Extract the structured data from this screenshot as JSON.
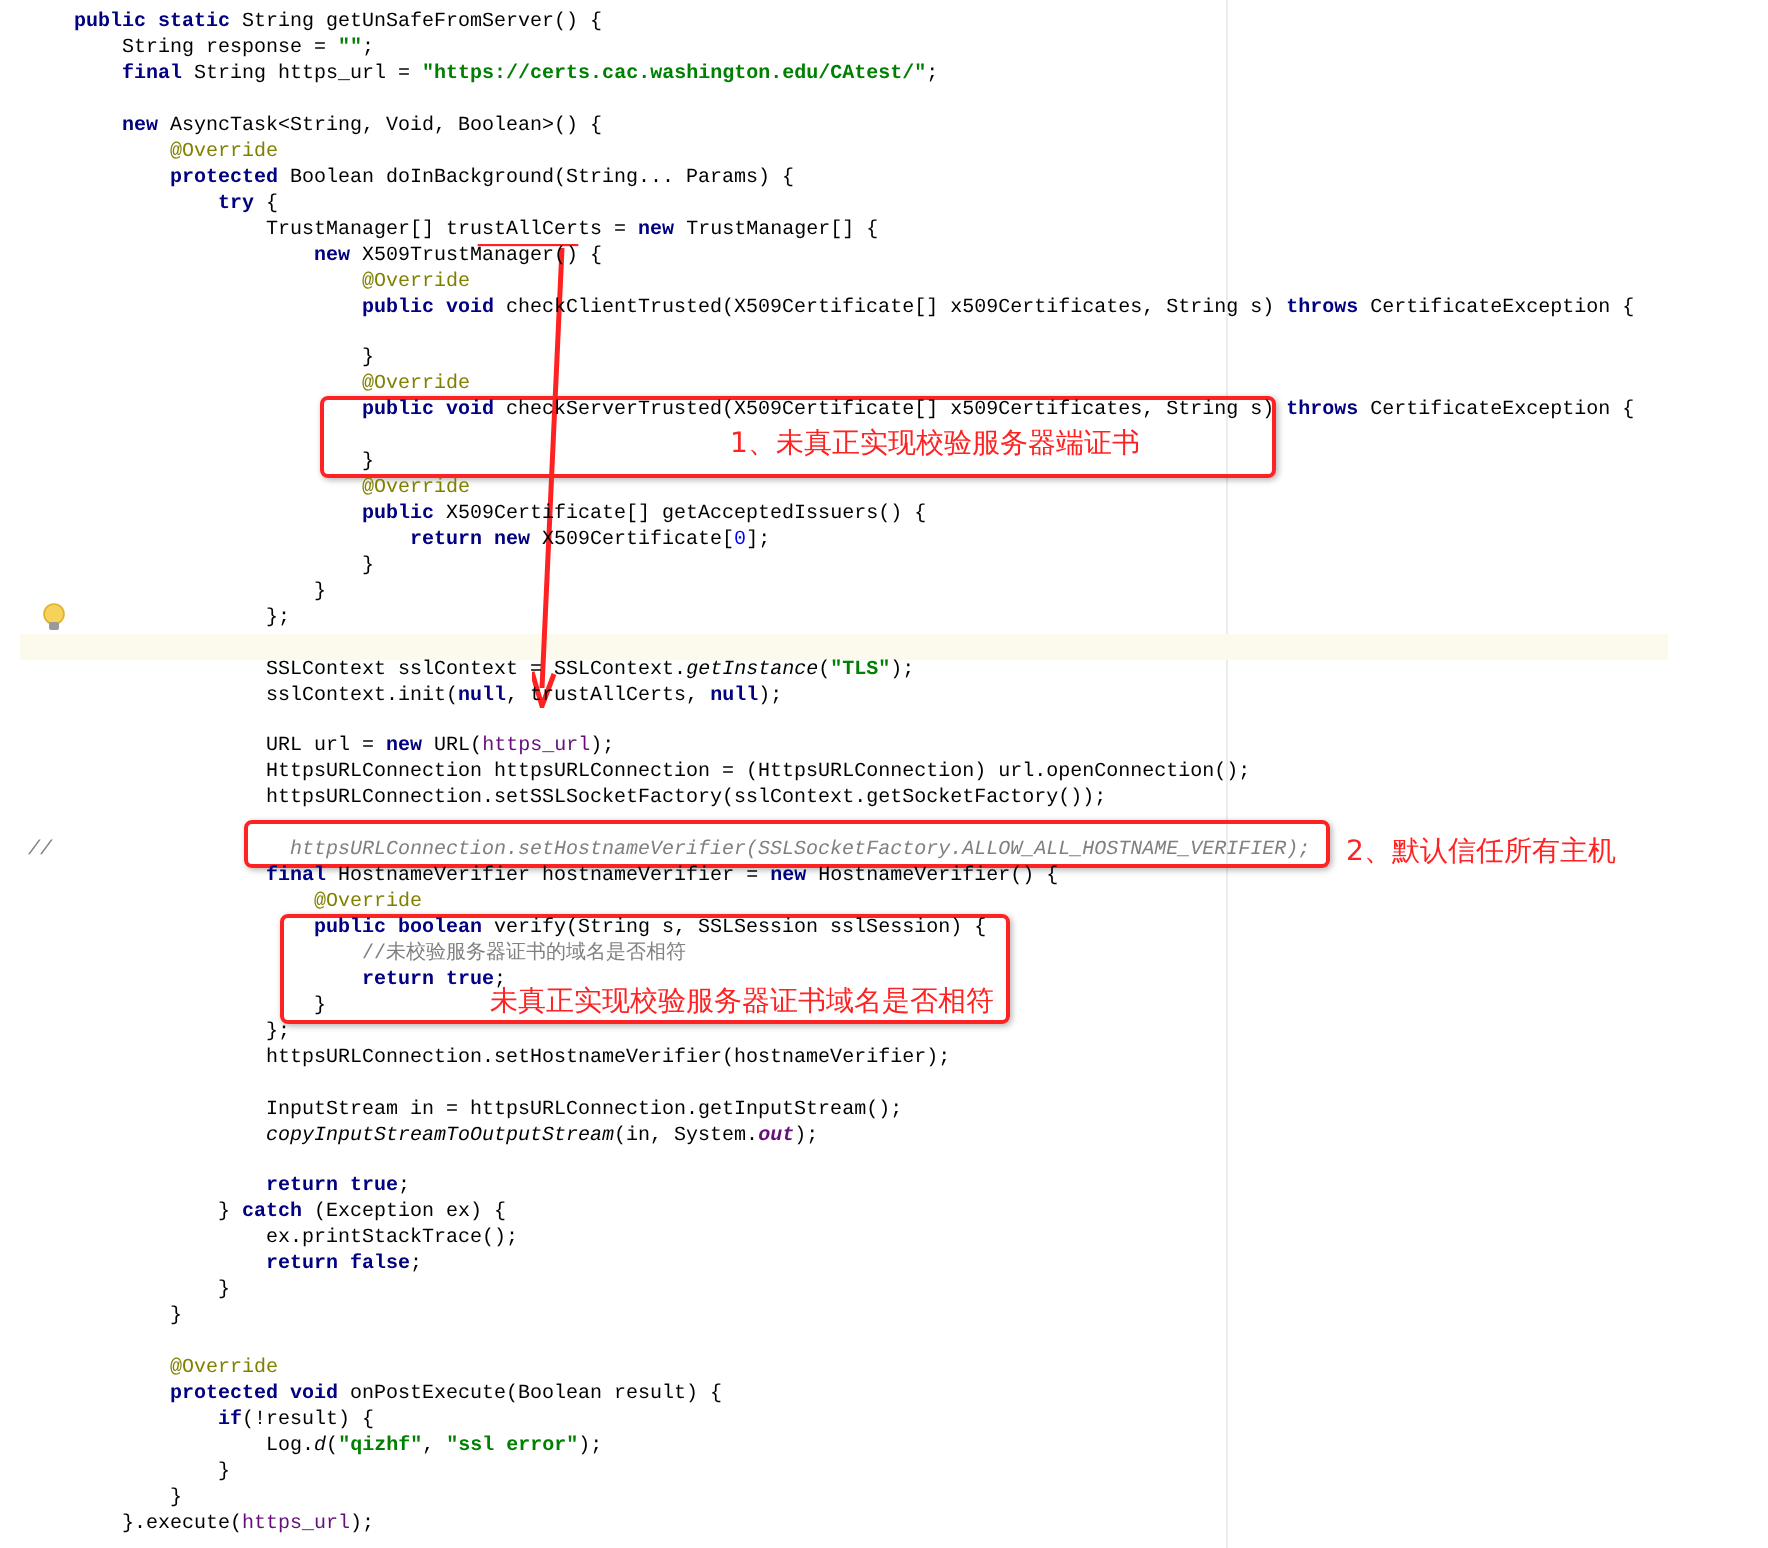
{
  "editor": {
    "lines": [
      {
        "current": false,
        "tokens": [
          {
            "kind": "kw",
            "text": "public static "
          },
          {
            "kind": "p",
            "text": "String getUnSafeFromServer() {"
          }
        ]
      },
      {
        "current": false,
        "tokens": [
          {
            "kind": "p",
            "text": "    String response = "
          },
          {
            "kind": "str",
            "text": "\"\""
          },
          {
            "kind": "p",
            "text": ";"
          }
        ]
      },
      {
        "current": false,
        "tokens": [
          {
            "kind": "kw",
            "text": "    final "
          },
          {
            "kind": "p",
            "text": "String https_url = "
          },
          {
            "kind": "str",
            "text": "\"https://certs.cac.washington.edu/CAtest/\""
          },
          {
            "kind": "p",
            "text": ";"
          }
        ]
      },
      {
        "current": false
      },
      {
        "current": false,
        "tokens": [
          {
            "kind": "kw",
            "text": "    new "
          },
          {
            "kind": "p",
            "text": "AsyncTask<String, Void, Boolean>() {"
          }
        ]
      },
      {
        "current": false,
        "tokens": [
          {
            "kind": "ann",
            "text": "        @Override"
          }
        ]
      },
      {
        "current": false,
        "tokens": [
          {
            "kind": "kw",
            "text": "        protected "
          },
          {
            "kind": "p",
            "text": "Boolean doInBackground(String... Params) {"
          }
        ]
      },
      {
        "current": false,
        "tokens": [
          {
            "kind": "kw",
            "text": "            try "
          },
          {
            "kind": "p",
            "text": "{"
          }
        ]
      },
      {
        "current": false,
        "tokens": [
          {
            "kind": "p",
            "text": "                TrustManager[] trustAllCerts = "
          },
          {
            "kind": "kw",
            "text": "new "
          },
          {
            "kind": "p",
            "text": "TrustManager[] {"
          }
        ]
      },
      {
        "current": false,
        "tokens": [
          {
            "kind": "kw",
            "text": "                    new "
          },
          {
            "kind": "p",
            "text": "X509TrustManager() {"
          }
        ]
      },
      {
        "current": false,
        "tokens": [
          {
            "kind": "ann",
            "text": "                        @Override"
          }
        ]
      },
      {
        "current": false,
        "tokens": [
          {
            "kind": "kw",
            "text": "                        public void "
          },
          {
            "kind": "p",
            "text": "checkClientTrusted(X509Certificate[] x509Certificates, String s) "
          },
          {
            "kind": "kw",
            "text": "throws "
          },
          {
            "kind": "p",
            "text": "CertificateException {"
          }
        ]
      },
      {
        "current": false
      },
      {
        "current": false,
        "tokens": [
          {
            "kind": "p",
            "text": "                        }"
          }
        ]
      },
      {
        "current": false,
        "tokens": [
          {
            "kind": "ann",
            "text": "                        @Override"
          }
        ]
      },
      {
        "current": false,
        "tokens": [
          {
            "kind": "kw",
            "text": "                        public void "
          },
          {
            "kind": "p",
            "text": "checkServerTrusted(X509Certificate[] x509Certificates, String s) "
          },
          {
            "kind": "kw",
            "text": "throws "
          },
          {
            "kind": "p",
            "text": "CertificateException {"
          }
        ]
      },
      {
        "current": false
      },
      {
        "current": false,
        "tokens": [
          {
            "kind": "p",
            "text": "                        }"
          }
        ]
      },
      {
        "current": false,
        "tokens": [
          {
            "kind": "ann",
            "text": "                        @Override"
          }
        ]
      },
      {
        "current": false,
        "tokens": [
          {
            "kind": "kw",
            "text": "                        public "
          },
          {
            "kind": "p",
            "text": "X509Certificate[] getAcceptedIssuers() {"
          }
        ]
      },
      {
        "current": false,
        "tokens": [
          {
            "kind": "kw",
            "text": "                            return new "
          },
          {
            "kind": "p",
            "text": "X509Certificate["
          },
          {
            "kind": "num",
            "text": "0"
          },
          {
            "kind": "p",
            "text": "];"
          }
        ]
      },
      {
        "current": false,
        "tokens": [
          {
            "kind": "p",
            "text": "                        }"
          }
        ]
      },
      {
        "current": false,
        "tokens": [
          {
            "kind": "p",
            "text": "                    }"
          }
        ]
      },
      {
        "current": false,
        "gutter_icon": {
          "kind": "bulb"
        },
        "tokens": [
          {
            "kind": "p",
            "text": "                };"
          }
        ]
      },
      {
        "current": true
      },
      {
        "current": false,
        "tokens": [
          {
            "kind": "p",
            "text": "                SSLContext sslContext = SSLContext."
          },
          {
            "kind": "it",
            "text": "getInstance"
          },
          {
            "kind": "p",
            "text": "("
          },
          {
            "kind": "str",
            "text": "\"TLS\""
          },
          {
            "kind": "p",
            "text": ");"
          }
        ]
      },
      {
        "current": false,
        "tokens": [
          {
            "kind": "p",
            "text": "                sslContext.init("
          },
          {
            "kind": "kw",
            "text": "null"
          },
          {
            "kind": "p",
            "text": ", trustAllCerts, "
          },
          {
            "kind": "kw",
            "text": "null"
          },
          {
            "kind": "p",
            "text": ");"
          }
        ]
      },
      {
        "current": false
      },
      {
        "current": false,
        "tokens": [
          {
            "kind": "p",
            "text": "                URL url = "
          },
          {
            "kind": "kw",
            "text": "new "
          },
          {
            "kind": "p",
            "text": "URL("
          },
          {
            "kind": "fld",
            "text": "https_url"
          },
          {
            "kind": "p",
            "text": ");"
          }
        ]
      },
      {
        "current": false,
        "tokens": [
          {
            "kind": "p",
            "text": "                HttpsURLConnection httpsURLConnection = (HttpsURLConnection) url.openConnection();"
          }
        ]
      },
      {
        "current": false,
        "tokens": [
          {
            "kind": "p",
            "text": "                httpsURLConnection.setSSLSocketFactory(sslContext.getSocketFactory());"
          }
        ]
      },
      {
        "current": false
      },
      {
        "current": false,
        "gutter": "//",
        "tokens": [
          {
            "kind": "cm",
            "text": "                  httpsURLConnection.setHostnameVerifier(SSLSocketFactory.ALLOW_ALL_HOSTNAME_VERIFIER);"
          }
        ]
      },
      {
        "current": false,
        "tokens": [
          {
            "kind": "kw",
            "text": "                final "
          },
          {
            "kind": "p",
            "text": "HostnameVerifier hostnameVerifier = "
          },
          {
            "kind": "kw",
            "text": "new "
          },
          {
            "kind": "p",
            "text": "HostnameVerifier() {"
          }
        ]
      },
      {
        "current": false,
        "tokens": [
          {
            "kind": "ann",
            "text": "                    @Override"
          }
        ]
      },
      {
        "current": false,
        "tokens": [
          {
            "kind": "kw",
            "text": "                    public boolean "
          },
          {
            "kind": "p",
            "text": "verify(String s, SSLSession sslSession) {"
          }
        ]
      },
      {
        "current": false,
        "tokens": [
          {
            "kind": "lc",
            "text": "                        //未校验服务器证书的域名是否相符"
          }
        ]
      },
      {
        "current": false,
        "tokens": [
          {
            "kind": "kw",
            "text": "                        return true"
          },
          {
            "kind": "p",
            "text": ";"
          }
        ]
      },
      {
        "current": false,
        "tokens": [
          {
            "kind": "p",
            "text": "                    }"
          }
        ]
      },
      {
        "current": false,
        "tokens": [
          {
            "kind": "p",
            "text": "                };"
          }
        ]
      },
      {
        "current": false,
        "tokens": [
          {
            "kind": "p",
            "text": "                httpsURLConnection.setHostnameVerifier(hostnameVerifier);"
          }
        ]
      },
      {
        "current": false
      },
      {
        "current": false,
        "tokens": [
          {
            "kind": "p",
            "text": "                InputStream in = httpsURLConnection.getInputStream();"
          }
        ]
      },
      {
        "current": false,
        "tokens": [
          {
            "kind": "it",
            "text": "                copyInputStreamToOutputStream"
          },
          {
            "kind": "p",
            "text": "(in, System."
          },
          {
            "kind": "fldit",
            "text": "out"
          },
          {
            "kind": "p",
            "text": ");"
          }
        ]
      },
      {
        "current": false
      },
      {
        "current": false,
        "tokens": [
          {
            "kind": "kw",
            "text": "                return true"
          },
          {
            "kind": "p",
            "text": ";"
          }
        ]
      },
      {
        "current": false,
        "tokens": [
          {
            "kind": "p",
            "text": "            } "
          },
          {
            "kind": "kw",
            "text": "catch "
          },
          {
            "kind": "p",
            "text": "(Exception ex) {"
          }
        ]
      },
      {
        "current": false,
        "tokens": [
          {
            "kind": "p",
            "text": "                ex.printStackTrace();"
          }
        ]
      },
      {
        "current": false,
        "tokens": [
          {
            "kind": "kw",
            "text": "                return false"
          },
          {
            "kind": "p",
            "text": ";"
          }
        ]
      },
      {
        "current": false,
        "tokens": [
          {
            "kind": "p",
            "text": "            }"
          }
        ]
      },
      {
        "current": false,
        "tokens": [
          {
            "kind": "p",
            "text": "        }"
          }
        ]
      },
      {
        "current": false
      },
      {
        "current": false,
        "tokens": [
          {
            "kind": "ann",
            "text": "        @Override"
          }
        ]
      },
      {
        "current": false,
        "tokens": [
          {
            "kind": "kw",
            "text": "        protected void "
          },
          {
            "kind": "p",
            "text": "onPostExecute(Boolean result) {"
          }
        ]
      },
      {
        "current": false,
        "tokens": [
          {
            "kind": "kw",
            "text": "            if"
          },
          {
            "kind": "p",
            "text": "(!result) {"
          }
        ]
      },
      {
        "current": false,
        "tokens": [
          {
            "kind": "p",
            "text": "                Log."
          },
          {
            "kind": "it",
            "text": "d"
          },
          {
            "kind": "p",
            "text": "("
          },
          {
            "kind": "str",
            "text": "\"qizhf\""
          },
          {
            "kind": "p",
            "text": ", "
          },
          {
            "kind": "str",
            "text": "\"ssl error\""
          },
          {
            "kind": "p",
            "text": ");"
          }
        ]
      },
      {
        "current": false,
        "tokens": [
          {
            "kind": "p",
            "text": "            }"
          }
        ]
      },
      {
        "current": false,
        "tokens": [
          {
            "kind": "p",
            "text": "        }"
          }
        ]
      },
      {
        "current": false,
        "tokens": [
          {
            "kind": "p",
            "text": "    }.execute("
          },
          {
            "kind": "fld",
            "text": "https_url"
          },
          {
            "kind": "p",
            "text": ");"
          }
        ]
      }
    ]
  },
  "annotations": [
    {
      "text": "1、未真正实现校验服务器端证书"
    },
    {
      "text": "2、默认信任所有主机"
    },
    {
      "text": "未真正实现校验服务器证书域名是否相符"
    }
  ]
}
